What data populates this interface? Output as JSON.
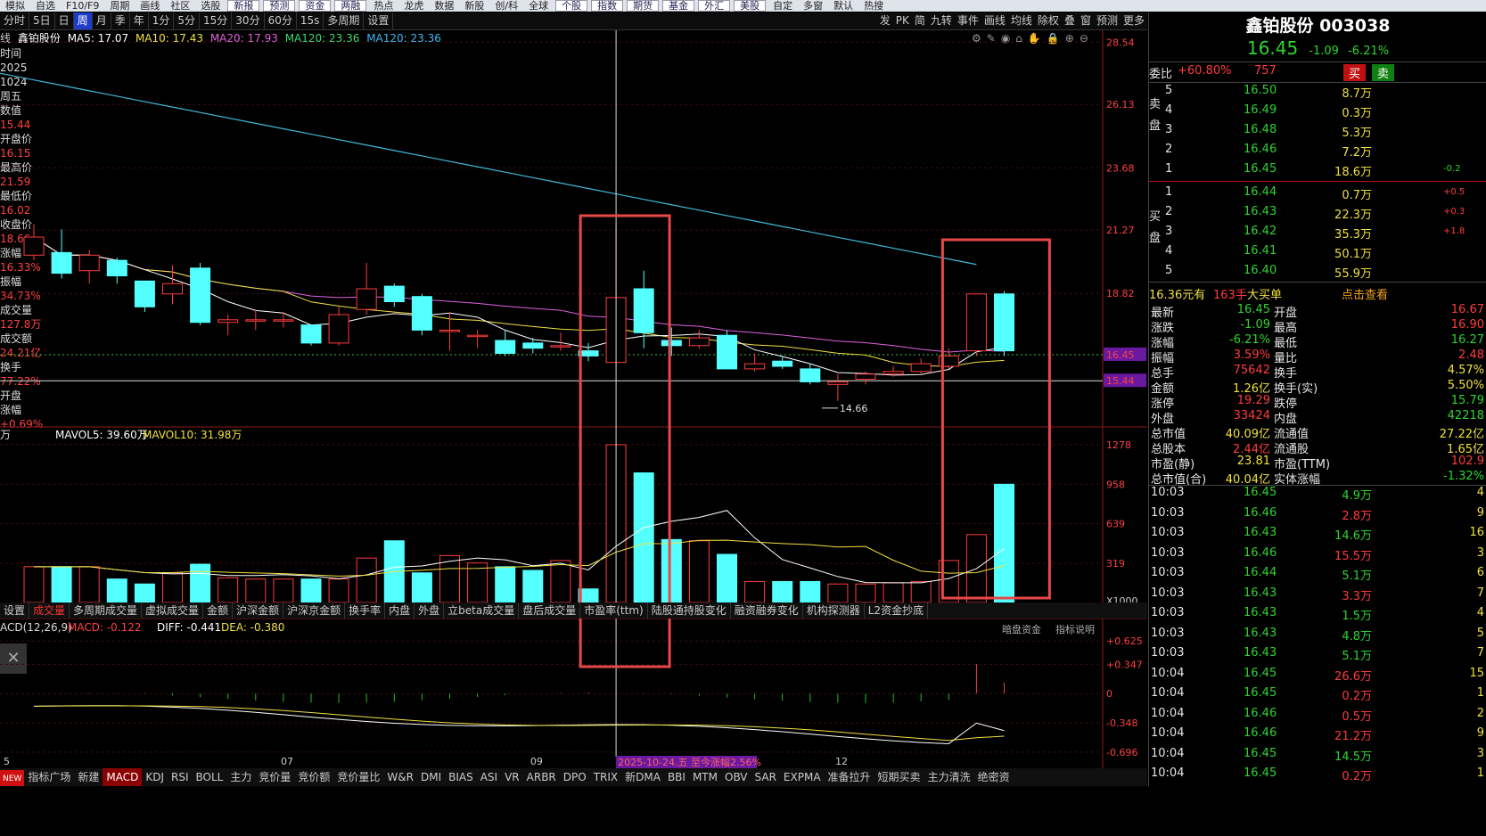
{
  "top_menu": [
    "模拟",
    "自选",
    "F10/F9",
    "周期",
    "画线",
    "社区",
    "选股",
    "新报",
    "预测",
    "资金",
    "两融",
    "热点",
    "龙虎",
    "数据",
    "新股",
    "创/科",
    "全球",
    "个股",
    "指数",
    "期货",
    "基金",
    "外汇",
    "美股",
    "自定",
    "多窗",
    "默认",
    "热搜"
  ],
  "period_bar": {
    "items": [
      "分时",
      "5日",
      "日",
      "周",
      "月",
      "季",
      "年",
      "1分",
      "5分",
      "15分",
      "30分",
      "60分",
      "15s",
      "多周期",
      "设置"
    ],
    "active": "周",
    "tools": [
      "发",
      "PK",
      "简",
      "九转",
      "事件",
      "画线",
      "均线",
      "除权",
      "叠",
      "窗",
      "预测",
      "更多"
    ]
  },
  "ma_legend": {
    "prefix": "线",
    "name": "鑫铂股份",
    "ma5": "MA5: 17.07",
    "ma10": "MA10: 17.43",
    "ma20": "MA20: 17.93",
    "ma120": "MA120: 23.36",
    "ma120b": "MA120: 23.36"
  },
  "side_info": [
    {
      "label": "时间",
      "value": "2025"
    },
    {
      "label": "",
      "value": "1024"
    },
    {
      "label": "周五",
      "value": ""
    },
    {
      "label": "数值",
      "value": "15.44"
    },
    {
      "label": "开盘价",
      "value": "16.15"
    },
    {
      "label": "最高价",
      "value": "21.59"
    },
    {
      "label": "最低价",
      "value": "16.02"
    },
    {
      "label": "收盘价",
      "value": "18.66"
    },
    {
      "label": "涨幅",
      "value": "16.33%"
    },
    {
      "label": "振幅",
      "value": "34.73%"
    },
    {
      "label": "成交量",
      "value": "127.8万"
    },
    {
      "label": "成交额",
      "value": "24.21亿"
    },
    {
      "label": "换手",
      "value": "77.22%"
    },
    {
      "label": "开盘",
      "value": ""
    },
    {
      "label": "涨幅",
      "value": "+0.69%"
    }
  ],
  "price_axis": [
    "28.54",
    "26.13",
    "23.68",
    "21.27",
    "18.82",
    "16.45",
    "15.44"
  ],
  "low_marker": "14.66",
  "vol_legend": {
    "prefix": "万",
    "mavol5": "MAVOL5: 39.60万",
    "mavol10": "MAVOL10: 31.98万"
  },
  "vol_axis": [
    "1278",
    "958",
    "639",
    "319",
    "X1000"
  ],
  "indicator_tabs": [
    "设置",
    "成交量",
    "多周期成交量",
    "虚拟成交量",
    "金额",
    "沪深金额",
    "沪深京金额",
    "换手率",
    "内盘",
    "外盘",
    "立beta成交量",
    "盘后成交量",
    "市盈率(ttm)",
    "陆股通持股变化",
    "融资融券变化",
    "机构探测器",
    "L2资金抄底"
  ],
  "indicator_tab_active": "成交量",
  "extra_tabs": [
    "暗盘资金",
    "指标说明"
  ],
  "macd_legend": {
    "name": "ACD(12,26,9)",
    "macd": "MACD: -0.122",
    "diff": "DIFF: -0.441",
    "dea": "DEA: -0.380"
  },
  "macd_axis": [
    "+0.625",
    "+0.347",
    "0",
    "-0.348",
    "-0.696"
  ],
  "x_axis": [
    "5",
    "07",
    "09",
    "12"
  ],
  "crosshair_date": "2025-10-24.五  至今涨幅2.56%",
  "bottom_tabs": [
    "NEW",
    "指标广场",
    "新建",
    "MACD",
    "KDJ",
    "RSI",
    "BOLL",
    "主力",
    "竞价量",
    "竞价额",
    "竞价量比",
    "W&R",
    "DMI",
    "BIAS",
    "ASI",
    "VR",
    "ARBR",
    "DPO",
    "TRIX",
    "新DMA",
    "BBI",
    "MTM",
    "OBV",
    "SAR",
    "EXPMA",
    "准备拉升",
    "短期买卖",
    "主力清洗",
    "绝密资"
  ],
  "bottom_tab_active": "MACD",
  "stock": {
    "name": "鑫铂股份",
    "code": "003038",
    "price": "16.45",
    "change": "-1.09",
    "pct": "-6.21%"
  },
  "weibi": {
    "label": "委比",
    "value": "+60.80%",
    "diff": "757",
    "buy": "买",
    "sell": "卖"
  },
  "asks": [
    {
      "level": "5",
      "price": "16.50",
      "vol": "8.7万"
    },
    {
      "level": "4",
      "price": "16.49",
      "vol": "0.3万"
    },
    {
      "level": "3",
      "price": "16.48",
      "vol": "5.3万"
    },
    {
      "level": "2",
      "price": "16.46",
      "vol": "7.2万"
    },
    {
      "level": "1",
      "price": "16.45",
      "vol": "18.6万",
      "chg": "-0.2"
    }
  ],
  "bids": [
    {
      "level": "1",
      "price": "16.44",
      "vol": "0.7万",
      "chg": "+0.5"
    },
    {
      "level": "2",
      "price": "16.43",
      "vol": "22.3万",
      "chg": "+0.3"
    },
    {
      "level": "3",
      "price": "16.42",
      "vol": "35.3万",
      "chg": "+1.8"
    },
    {
      "level": "4",
      "price": "16.41",
      "vol": "50.1万"
    },
    {
      "level": "5",
      "price": "16.40",
      "vol": "55.9万"
    }
  ],
  "ask_side_label": "卖盘",
  "bid_side_label": "买盘",
  "big_order": {
    "price": "16.36元有",
    "qty": "163手",
    "type": "大买单",
    "link": "点击查看"
  },
  "quote": [
    {
      "l": "最新",
      "lv": "16.45",
      "r": "开盘",
      "rv": "16.67"
    },
    {
      "l": "涨跌",
      "lv": "-1.09",
      "r": "最高",
      "rv": "16.90"
    },
    {
      "l": "涨幅",
      "lv": "-6.21%",
      "r": "最低",
      "rv": "16.27"
    },
    {
      "l": "振幅",
      "lv": "3.59%",
      "r": "量比",
      "rv": "2.48"
    },
    {
      "l": "总手",
      "lv": "75642",
      "r": "换手",
      "rv": "4.57%"
    },
    {
      "l": "金额",
      "lv": "1.26亿",
      "r": "换手(实)",
      "rv": "5.50%"
    },
    {
      "l": "涨停",
      "lv": "19.29",
      "r": "跌停",
      "rv": "15.79"
    },
    {
      "l": "外盘",
      "lv": "33424",
      "r": "内盘",
      "rv": "42218"
    },
    {
      "l": "总市值",
      "lv": "40.09亿",
      "r": "流通值",
      "rv": "27.22亿"
    },
    {
      "l": "总股本",
      "lv": "2.44亿",
      "r": "流通股",
      "rv": "1.65亿"
    },
    {
      "l": "市盈(静)",
      "lv": "23.81",
      "r": "市盈(TTM)",
      "rv": "102.9"
    },
    {
      "l": "总市值(合)",
      "lv": "40.04亿",
      "r": "实体涨幅",
      "rv": "-1.32%"
    }
  ],
  "ticks": [
    {
      "t": "10:03",
      "p": "16.45",
      "v": "4.9万",
      "n": "4"
    },
    {
      "t": "10:03",
      "p": "16.46",
      "v": "2.8万",
      "n": "9"
    },
    {
      "t": "10:03",
      "p": "16.43",
      "v": "14.6万",
      "n": "16"
    },
    {
      "t": "10:03",
      "p": "16.46",
      "v": "15.5万",
      "n": "3"
    },
    {
      "t": "10:03",
      "p": "16.44",
      "v": "5.1万",
      "n": "6"
    },
    {
      "t": "10:03",
      "p": "16.43",
      "v": "3.3万",
      "n": "7"
    },
    {
      "t": "10:03",
      "p": "16.43",
      "v": "1.5万",
      "n": "4"
    },
    {
      "t": "10:03",
      "p": "16.43",
      "v": "4.8万",
      "n": "5"
    },
    {
      "t": "10:03",
      "p": "16.43",
      "v": "5.1万",
      "n": "7"
    },
    {
      "t": "10:04",
      "p": "16.45",
      "v": "26.6万",
      "n": "15"
    },
    {
      "t": "10:04",
      "p": "16.45",
      "v": "0.2万",
      "n": "1"
    },
    {
      "t": "10:04",
      "p": "16.46",
      "v": "0.5万",
      "n": "2"
    },
    {
      "t": "10:04",
      "p": "16.46",
      "v": "21.2万",
      "n": "9"
    },
    {
      "t": "10:04",
      "p": "16.45",
      "v": "14.5万",
      "n": "3"
    },
    {
      "t": "10:04",
      "p": "16.45",
      "v": "0.2万",
      "n": "1"
    }
  ],
  "colors": {
    "up": "#ff3c3c",
    "down": "#54ffff",
    "ma5": "#ffffff",
    "ma10": "#f0e040",
    "ma20": "#e060e0",
    "ma120": "#40b8d8",
    "highlight": "#e84848"
  },
  "candles": [
    {
      "o": 20.3,
      "c": 21.0,
      "h": 21.5,
      "l": 20.1
    },
    {
      "o": 20.4,
      "c": 19.6,
      "h": 21.3,
      "l": 19.4
    },
    {
      "o": 19.7,
      "c": 20.3,
      "h": 20.5,
      "l": 19.2
    },
    {
      "o": 20.1,
      "c": 19.5,
      "h": 20.2,
      "l": 19.2
    },
    {
      "o": 19.3,
      "c": 18.3,
      "h": 19.3,
      "l": 18.1
    },
    {
      "o": 18.8,
      "c": 19.2,
      "h": 19.9,
      "l": 18.4
    },
    {
      "o": 19.8,
      "c": 17.7,
      "h": 20.0,
      "l": 17.6
    },
    {
      "o": 17.7,
      "c": 17.8,
      "h": 18.0,
      "l": 17.2
    },
    {
      "o": 17.8,
      "c": 17.8,
      "h": 18.2,
      "l": 17.4
    },
    {
      "o": 17.8,
      "c": 17.8,
      "h": 18.1,
      "l": 17.5
    },
    {
      "o": 17.6,
      "c": 16.9,
      "h": 17.6,
      "l": 16.8
    },
    {
      "o": 16.9,
      "c": 18.0,
      "h": 18.3,
      "l": 16.8
    },
    {
      "o": 18.2,
      "c": 19.0,
      "h": 20.0,
      "l": 18.0
    },
    {
      "o": 19.1,
      "c": 18.5,
      "h": 19.2,
      "l": 18.3
    },
    {
      "o": 18.7,
      "c": 17.4,
      "h": 18.8,
      "l": 17.2
    },
    {
      "o": 17.4,
      "c": 17.4,
      "h": 18.1,
      "l": 16.6
    },
    {
      "o": 17.2,
      "c": 17.2,
      "h": 17.4,
      "l": 16.7
    },
    {
      "o": 17.0,
      "c": 16.5,
      "h": 17.4,
      "l": 16.4
    },
    {
      "o": 16.9,
      "c": 16.7,
      "h": 17.1,
      "l": 16.5
    },
    {
      "o": 16.8,
      "c": 16.8,
      "h": 17.3,
      "l": 16.6
    },
    {
      "o": 16.6,
      "c": 16.4,
      "h": 16.9,
      "l": 16.2
    },
    {
      "o": 16.15,
      "c": 18.66,
      "h": 21.59,
      "l": 16.02
    },
    {
      "o": 19.0,
      "c": 17.3,
      "h": 19.7,
      "l": 16.7
    },
    {
      "o": 17.0,
      "c": 16.8,
      "h": 17.5,
      "l": 16.4
    },
    {
      "o": 16.8,
      "c": 17.1,
      "h": 17.4,
      "l": 16.7
    },
    {
      "o": 17.2,
      "c": 15.9,
      "h": 17.4,
      "l": 15.9
    },
    {
      "o": 15.9,
      "c": 16.1,
      "h": 16.5,
      "l": 15.8
    },
    {
      "o": 16.2,
      "c": 16.0,
      "h": 16.4,
      "l": 15.9
    },
    {
      "o": 15.9,
      "c": 15.4,
      "h": 16.1,
      "l": 15.3
    },
    {
      "o": 15.3,
      "c": 15.4,
      "h": 15.7,
      "l": 14.66
    },
    {
      "o": 15.5,
      "c": 15.7,
      "h": 15.8,
      "l": 15.3
    },
    {
      "o": 15.7,
      "c": 15.8,
      "h": 16.0,
      "l": 15.6
    },
    {
      "o": 15.8,
      "c": 16.1,
      "h": 16.3,
      "l": 15.7
    },
    {
      "o": 16.0,
      "c": 16.4,
      "h": 16.7,
      "l": 15.9
    },
    {
      "o": 16.6,
      "c": 18.8,
      "h": 18.8,
      "l": 16.4
    },
    {
      "o": 18.8,
      "c": 16.6,
      "h": 18.9,
      "l": 16.4
    }
  ],
  "volumes": [
    290,
    290,
    290,
    190,
    150,
    240,
    310,
    200,
    190,
    190,
    190,
    190,
    360,
    500,
    240,
    380,
    320,
    290,
    260,
    340,
    110,
    1278,
    1050,
    510,
    500,
    390,
    170,
    170,
    170,
    150,
    150,
    160,
    170,
    340,
    550,
    958
  ]
}
